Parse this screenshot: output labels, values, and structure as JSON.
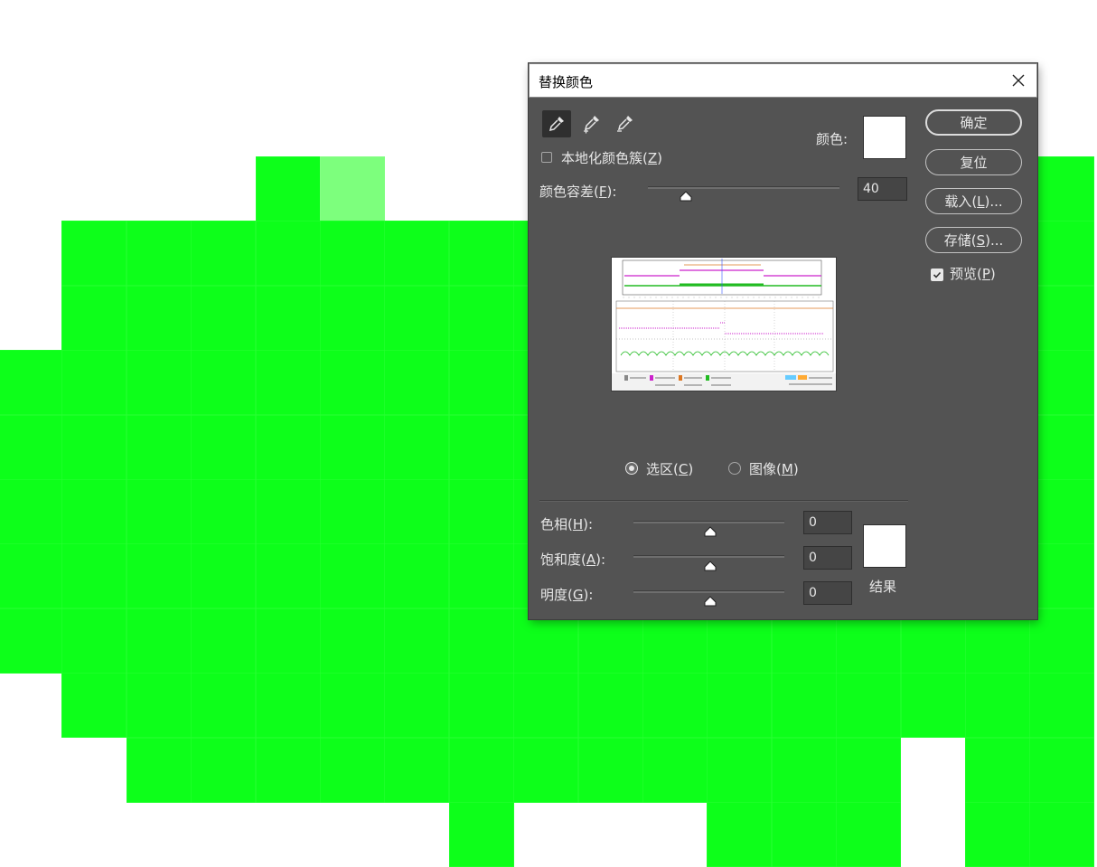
{
  "dialog": {
    "title": "替换颜色",
    "localized_label": "本地化颜色簇(",
    "localized_key": "Z",
    "tolerance_label": "颜色容差(",
    "tolerance_key": "F",
    "tolerance_value": "40",
    "color_label": "颜色:",
    "radio_selection_label": "选区(",
    "radio_selection_key": "C",
    "radio_image_label": "图像(",
    "radio_image_key": "M",
    "hue_label": "色相(",
    "hue_key": "H",
    "hue_value": "0",
    "saturation_label": "饱和度(",
    "saturation_key": "A",
    "saturation_value": "0",
    "lightness_label": "明度(",
    "lightness_key": "G",
    "lightness_value": "0",
    "result_label": "结果",
    "buttons": {
      "ok": "确定",
      "reset": "复位",
      "load_prefix": "载入(",
      "load_key": "L",
      "load_suffix": ")...",
      "save_prefix": "存储(",
      "save_key": "S",
      "save_suffix": ")..."
    },
    "preview_label": "预览(",
    "preview_key": "P",
    "preview_checked": true,
    "selection_mode": "selection"
  },
  "colors": {
    "canvas_green": "#0dff1a",
    "canvas_light": "#7dff7d",
    "dialog_bg": "#535353",
    "swatch": "#ffffff"
  },
  "icons": [
    "eyedropper-icon",
    "eyedropper-add-icon",
    "eyedropper-subtract-icon",
    "close-icon",
    "slider-thumb-icon",
    "checkmark-icon"
  ]
}
